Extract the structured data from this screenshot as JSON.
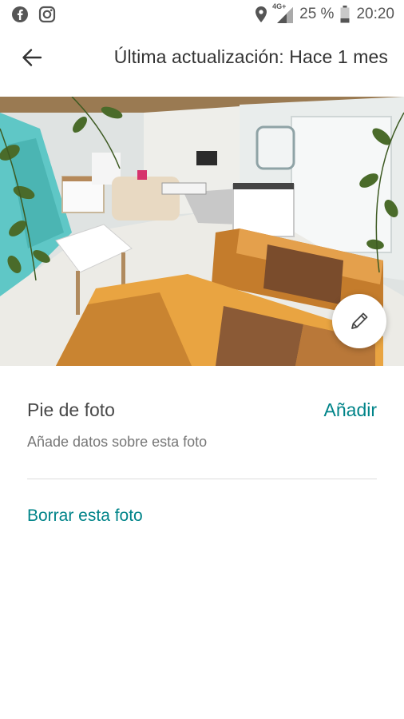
{
  "status_bar": {
    "left_icons": [
      "facebook-icon",
      "instagram-icon"
    ],
    "network": "4G+",
    "battery_percent": "25 %",
    "time": "20:20"
  },
  "app_bar": {
    "back_icon": "arrow-left-icon",
    "title": "Última actualización: Hace 1 mes"
  },
  "photo": {
    "edit_icon": "pencil-icon"
  },
  "caption": {
    "label": "Pie de foto",
    "action": "Añadir",
    "hint": "Añade datos sobre esta foto"
  },
  "actions": {
    "delete_label": "Borrar esta foto"
  },
  "colors": {
    "accent": "#008489",
    "text": "#484848",
    "hint": "#767676"
  }
}
